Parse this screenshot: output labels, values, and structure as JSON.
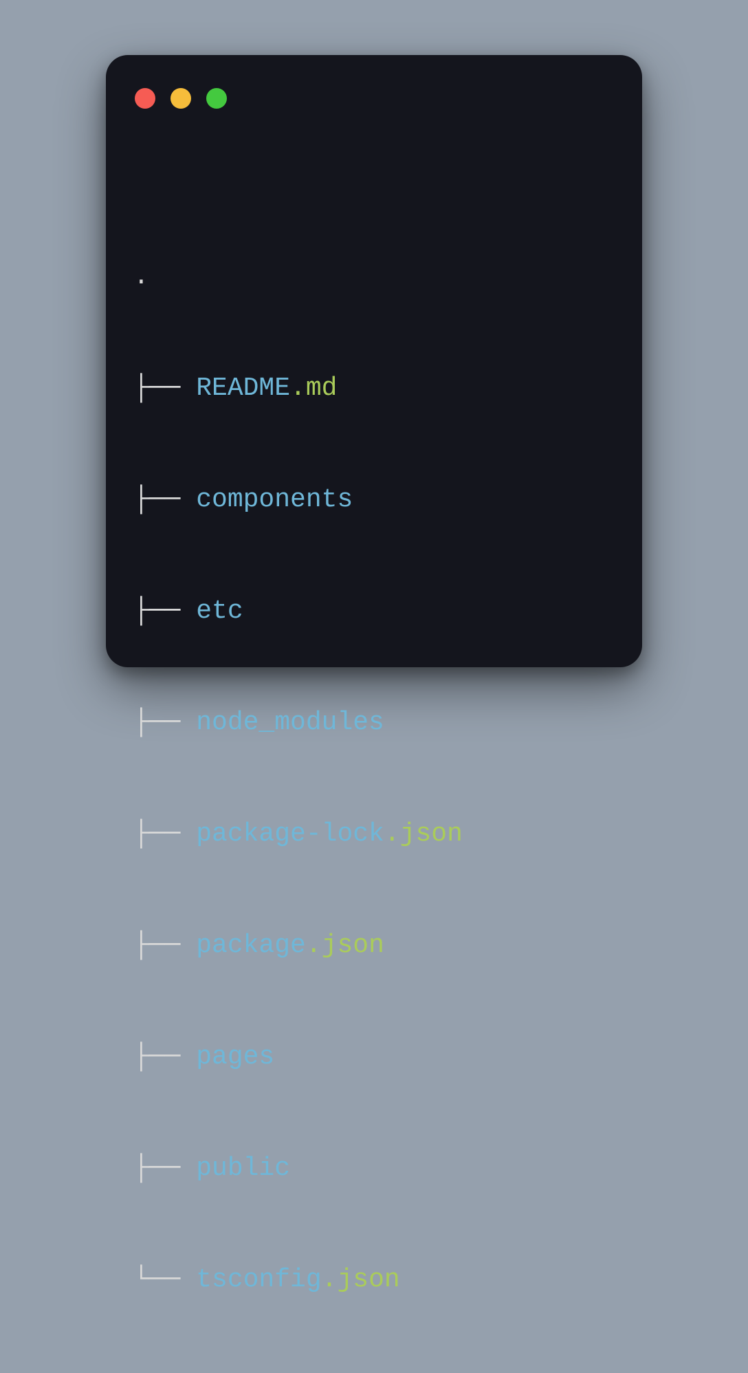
{
  "tree": {
    "root": ".",
    "rows": [
      {
        "prefix": "├── ",
        "name": "README",
        "ext": ".md",
        "last": false
      },
      {
        "prefix": "├── ",
        "name": "components",
        "ext": "",
        "last": false
      },
      {
        "prefix": "├── ",
        "name": "etc",
        "ext": "",
        "last": false
      },
      {
        "prefix": "├── ",
        "name": "node_modules",
        "ext": "",
        "last": false
      },
      {
        "prefix": "├── ",
        "name": "package-lock",
        "ext": ".json",
        "last": false
      },
      {
        "prefix": "├── ",
        "name": "package",
        "ext": ".json",
        "last": false
      },
      {
        "prefix": "├── ",
        "name": "pages",
        "ext": "",
        "last": false
      },
      {
        "prefix": "├── ",
        "name": "public",
        "ext": "",
        "last": false
      },
      {
        "prefix": "└── ",
        "name": "tsconfig",
        "ext": ".json",
        "last": true
      }
    ]
  },
  "colors": {
    "window_bg": "#14151d",
    "page_bg": "#95a0ad",
    "name_color": "#6fb7d8",
    "ext_color": "#aacc5a",
    "pipe_color": "#d8d8d8",
    "traffic_red": "#f65c54",
    "traffic_yellow": "#f6bd3b",
    "traffic_green": "#44c93f"
  }
}
